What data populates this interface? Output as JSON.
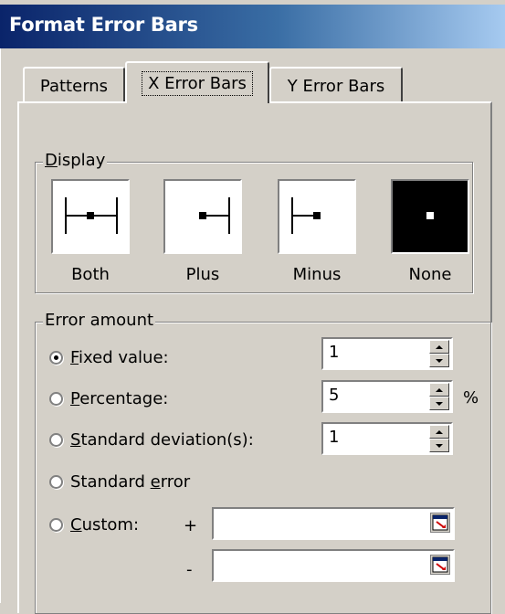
{
  "window": {
    "title": "Format Error Bars"
  },
  "tabs": [
    {
      "label": "Patterns",
      "active": false
    },
    {
      "label": "X Error Bars",
      "active": true
    },
    {
      "label": "Y Error Bars",
      "active": false
    }
  ],
  "display": {
    "legend": "Display",
    "legend_underline": "D",
    "legend_rest": "isplay",
    "options": [
      {
        "label": "Both",
        "icon": "error-bar-both-icon",
        "selected": false
      },
      {
        "label": "Plus",
        "icon": "error-bar-plus-icon",
        "selected": false
      },
      {
        "label": "Minus",
        "icon": "error-bar-minus-icon",
        "selected": false
      },
      {
        "label": "None",
        "icon": "error-bar-none-icon",
        "selected": true
      }
    ]
  },
  "error_amount": {
    "legend": "Error amount",
    "fixed_value": {
      "underline": "F",
      "rest": "ixed value:",
      "value": "1",
      "selected": true
    },
    "percentage": {
      "underline": "P",
      "rest": "ercentage:",
      "value": "5",
      "unit": "%",
      "selected": false
    },
    "std_dev": {
      "underline": "S",
      "rest": "tandard deviation(s):",
      "value": "1",
      "selected": false
    },
    "std_error": {
      "before": "Standard ",
      "underline": "e",
      "rest": "rror",
      "selected": false
    },
    "custom": {
      "underline": "C",
      "rest": "ustom:",
      "selected": false,
      "plus_sign": "+",
      "minus_sign": "-",
      "plus_value": "",
      "minus_value": ""
    }
  },
  "colors": {
    "face": "#d4d0c8",
    "title_start": "#0a246a",
    "title_end": "#a6caf0",
    "ref_icon_red": "#cc0000"
  }
}
